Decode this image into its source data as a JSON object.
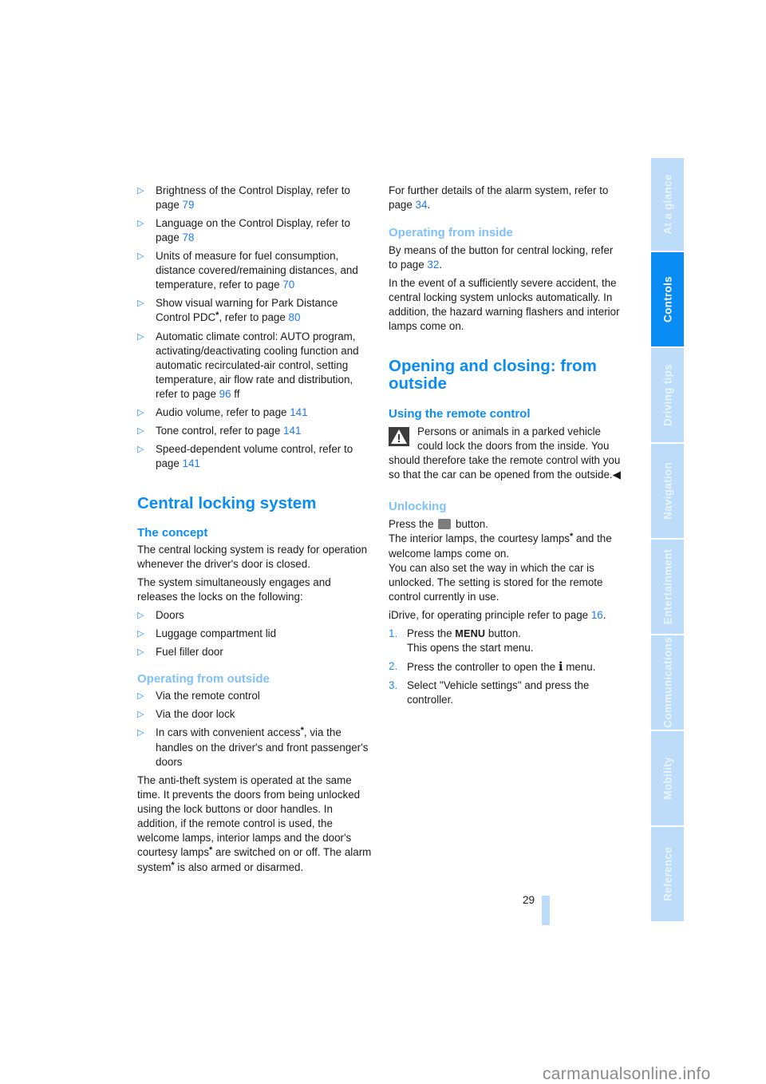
{
  "left_column": {
    "settings_list": [
      {
        "text": "Brightness of the Control Display, refer to page ",
        "link": "79",
        "suffix": ""
      },
      {
        "text": "Language on the Control Display, refer to page ",
        "link": "78",
        "suffix": ""
      },
      {
        "text": "Units of measure for fuel consumption, distance covered/remaining distances, and temperature, refer to page ",
        "link": "70",
        "suffix": ""
      },
      {
        "text_a": "Show visual warning for Park Distance Control PDC",
        "star": "*",
        "text_b": ", refer to page ",
        "link": "80"
      },
      {
        "text": "Automatic climate control: AUTO program, activating/deactivating cooling function and automatic recirculated-air control, setting temperature, air flow rate and distribution, refer to page ",
        "link": "96",
        "suffix": " ff"
      },
      {
        "text": "Audio volume, refer to page ",
        "link": "141",
        "suffix": ""
      },
      {
        "text": "Tone control, refer to page ",
        "link": "141",
        "suffix": ""
      },
      {
        "text": "Speed-dependent volume control, refer to page ",
        "link": "141",
        "suffix": ""
      }
    ],
    "section_title": "Central locking system",
    "concept": {
      "heading": "The concept",
      "para1": "The central locking system is ready for operation whenever the driver's door is closed.",
      "para2": "The system simultaneously engages and releases the locks on the following:",
      "items": [
        "Doors",
        "Luggage compartment lid",
        "Fuel filler door"
      ]
    },
    "outside": {
      "heading": "Operating from outside",
      "items": [
        "Via the remote control",
        "Via the door lock"
      ],
      "item3_a": "In cars with convenient access",
      "item3_star": "*",
      "item3_b": ", via the handles on the driver's and front passenger's doors",
      "para_a": "The anti-theft system is operated at the same time. It prevents the doors from being unlocked using the lock buttons or door handles. In addition, if the remote control is used, the welcome lamps, interior lamps and the door's courtesy lamps",
      "para_star1": "*",
      "para_b": " are switched on or off. The alarm system",
      "para_star2": "*",
      "para_c": " is also armed or disarmed."
    }
  },
  "right_column": {
    "alarm_ref": {
      "text": "For further details of the alarm system, refer to page ",
      "link": "34",
      "suffix": "."
    },
    "inside": {
      "heading": "Operating from inside",
      "para1_text": "By means of the button for central locking, refer to page ",
      "para1_link": "32",
      "para1_suffix": ".",
      "para2": "In the event of a sufficiently severe accident, the central locking system unlocks automatically. In addition, the hazard warning flashers and interior lamps come on."
    },
    "section_title": "Opening and closing: from outside",
    "remote": {
      "heading": "Using the remote control",
      "warning": "Persons or animals in a parked vehicle could lock the doors from the inside. You should therefore take the remote control with you so that the car can be opened from the outside.",
      "end_mark": "◀"
    },
    "unlocking": {
      "heading": "Unlocking",
      "press_a": "Press the ",
      "press_b": " button.",
      "lamps_a": "The interior lamps, the courtesy lamps",
      "lamps_star": "*",
      "lamps_b": " and the welcome lamps come on.",
      "setting": "You can also set the way in which the car is unlocked. The setting is stored for the remote control currently in use.",
      "idrive_text": "iDrive, for operating principle refer to page ",
      "idrive_link": "16",
      "idrive_suffix": ".",
      "steps": [
        {
          "num": "1.",
          "a": "Press the ",
          "key": "MENU",
          "b": " button.",
          "sub": "This opens the start menu."
        },
        {
          "num": "2.",
          "a": "Press the controller to open the ",
          "key": "i",
          "b": " menu."
        },
        {
          "num": "3.",
          "a": "Select \"Vehicle settings\" and press the controller."
        }
      ]
    }
  },
  "side_tabs": [
    {
      "label": "At a glance",
      "active": false
    },
    {
      "label": "Controls",
      "active": true
    },
    {
      "label": "Driving tips",
      "active": false
    },
    {
      "label": "Navigation",
      "active": false
    },
    {
      "label": "Entertainment",
      "active": false
    },
    {
      "label": "Communications",
      "active": false
    },
    {
      "label": "Mobility",
      "active": false
    },
    {
      "label": "Reference",
      "active": false
    }
  ],
  "page_number": "29",
  "watermark": "carmanualsonline.info",
  "bullet_glyph": "▷",
  "colors": {
    "accent": "#0a8cf5",
    "subheading": "#7ec1fa",
    "link": "#1e78f0",
    "tab_inactive": "#bcdcfa"
  }
}
